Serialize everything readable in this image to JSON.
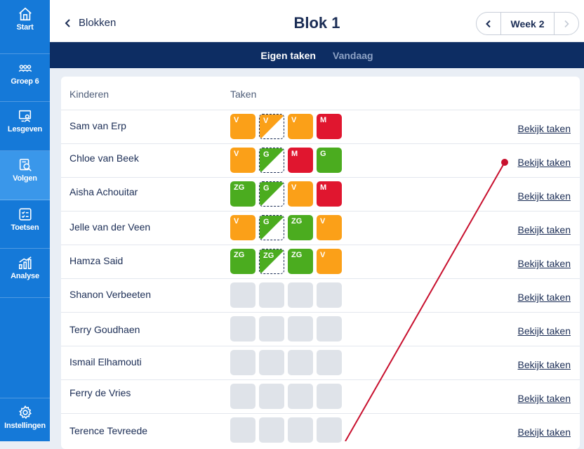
{
  "sidebar": {
    "items": [
      {
        "label": "Start",
        "icon": "home-icon"
      },
      {
        "label": "Groep 6",
        "icon": "group-icon"
      },
      {
        "label": "Lesgeven",
        "icon": "teach-icon"
      },
      {
        "label": "Volgen",
        "icon": "follow-icon"
      },
      {
        "label": "Toetsen",
        "icon": "test-icon"
      },
      {
        "label": "Analyse",
        "icon": "chart-icon"
      }
    ],
    "settings_label": "Instellingen",
    "active": "Volgen"
  },
  "header": {
    "back_label": "Blokken",
    "title": "Blok 1",
    "week_label": "Week 2"
  },
  "subnav": {
    "tab_active": "Eigen taken",
    "tab_inactive": "Vandaag"
  },
  "table": {
    "col_children": "Kinderen",
    "col_tasks": "Taken",
    "link_label": "Bekijk taken",
    "rows": [
      {
        "name": "Sam van Erp",
        "tasks": [
          {
            "label": "V",
            "color": "orange"
          },
          {
            "label": "V",
            "color": "orange",
            "half": true
          },
          {
            "label": "V",
            "color": "orange"
          },
          {
            "label": "M",
            "color": "red"
          }
        ]
      },
      {
        "name": "Chloe van Beek",
        "tasks": [
          {
            "label": "V",
            "color": "orange"
          },
          {
            "label": "G",
            "color": "green",
            "half": true
          },
          {
            "label": "M",
            "color": "red"
          },
          {
            "label": "G",
            "color": "green"
          }
        ]
      },
      {
        "name": "Aisha Achouitar",
        "tasks": [
          {
            "label": "ZG",
            "color": "green"
          },
          {
            "label": "G",
            "color": "green",
            "half": true
          },
          {
            "label": "V",
            "color": "orange"
          },
          {
            "label": "M",
            "color": "red"
          }
        ]
      },
      {
        "name": "Jelle van der Veen",
        "tasks": [
          {
            "label": "V",
            "color": "orange"
          },
          {
            "label": "G",
            "color": "green",
            "half": true
          },
          {
            "label": "ZG",
            "color": "green"
          },
          {
            "label": "V",
            "color": "orange"
          }
        ]
      },
      {
        "name": "Hamza Said",
        "tasks": [
          {
            "label": "ZG",
            "color": "green"
          },
          {
            "label": "ZG",
            "color": "green",
            "half": true
          },
          {
            "label": "ZG",
            "color": "green"
          },
          {
            "label": "V",
            "color": "orange"
          }
        ]
      },
      {
        "name": "Shanon Verbeeten",
        "tasks": [
          {
            "color": "grey"
          },
          {
            "color": "grey"
          },
          {
            "color": "grey"
          },
          {
            "color": "grey"
          }
        ]
      },
      {
        "name": "Terry Goudhaen",
        "tasks": [
          {
            "color": "grey"
          },
          {
            "color": "grey"
          },
          {
            "color": "grey"
          },
          {
            "color": "grey"
          }
        ]
      },
      {
        "name": "Ismail Elhamouti",
        "tasks": [
          {
            "color": "grey"
          },
          {
            "color": "grey"
          },
          {
            "color": "grey"
          },
          {
            "color": "grey"
          }
        ]
      },
      {
        "name": "Ferry de Vries",
        "tasks": [
          {
            "color": "grey"
          },
          {
            "color": "grey"
          },
          {
            "color": "grey"
          },
          {
            "color": "grey"
          }
        ]
      },
      {
        "name": "Terence Tevreede",
        "tasks": [
          {
            "color": "grey"
          },
          {
            "color": "grey"
          },
          {
            "color": "grey"
          },
          {
            "color": "grey"
          }
        ]
      }
    ]
  },
  "colors": {
    "orange": "#fba018",
    "green": "#4bac1f",
    "red": "#e0162f",
    "grey": "#dfe3e9",
    "annotation": "#c8102e"
  }
}
